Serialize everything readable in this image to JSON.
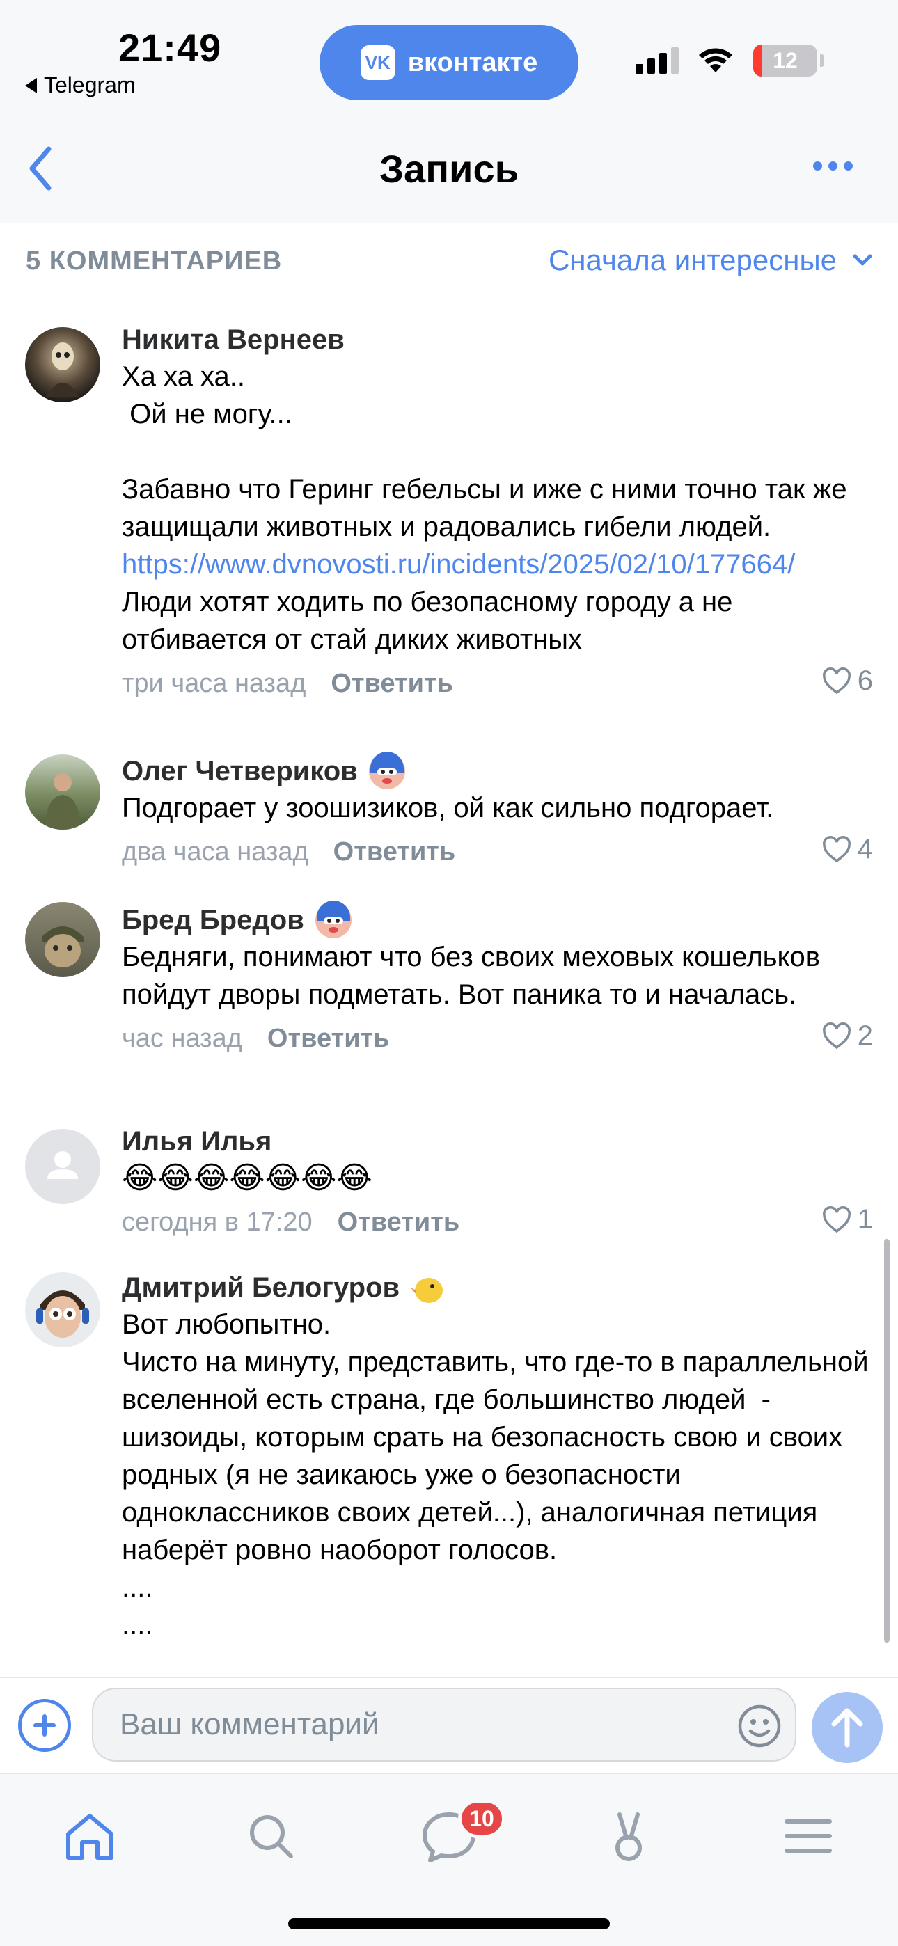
{
  "status_bar": {
    "time": "21:49",
    "back_app": "Telegram",
    "pill_label": "вконтакте",
    "battery": "12",
    "accent": "#4f86ec"
  },
  "nav": {
    "title": "Запись",
    "back_icon": "chevron-left-icon",
    "more_icon": "more-horizontal-icon"
  },
  "comments_header": {
    "count": "5 КОММЕНТАРИЕВ",
    "sort": "Сначала интересные"
  },
  "comments": [
    {
      "author": "Никита Вернеев",
      "text_before": "Ха ха ха..\n Ой не могу...\n\nЗабавно что Геринг гебельсы и иже с ними точно так же защищали животных и радовались гибели людей.",
      "link": "https://www.dvnovosti.ru/incidents/2025/02/10/177664/",
      "text_after": "Люди хотят ходить по безопасному городу а не отбивается от стай диких животных",
      "time": "три часа назад",
      "reply": "Ответить",
      "likes": "6"
    },
    {
      "author": "Олег Четвериков",
      "text": "Подгорает у зоошизиков, ой как сильно подгорает.",
      "time": "два часа назад",
      "reply": "Ответить",
      "likes": "4"
    },
    {
      "author": "Бред Бредов",
      "text": "Бедняги, понимают что без своих меховых кошельков пойдут дворы подметать. Вот паника то и началась.",
      "time": "час назад",
      "reply": "Ответить",
      "likes": "2"
    },
    {
      "author": "Илья Илья",
      "text": "😂😂😂😂😂😂😂",
      "time": "сегодня в 17:20",
      "reply": "Ответить",
      "likes": "1"
    },
    {
      "author": "Дмитрий Белогуров",
      "text": "Вот любопытно.\nЧисто на минуту, представить, что где-то в параллельной вселенной есть страна, где большинство людей  - шизоиды, которым срать на безопасность свою и своих родных (я не заикаюсь уже о безопасности одноклассников своих детей...), аналогичная петиция наберёт ровно наоборот голосов.\n....\n...."
    }
  ],
  "input": {
    "placeholder": "Ваш комментарий"
  },
  "tabbar": {
    "messages_badge": "10",
    "tabs": [
      "home-icon",
      "search-icon",
      "messages-icon",
      "clips-icon",
      "menu-icon"
    ]
  }
}
